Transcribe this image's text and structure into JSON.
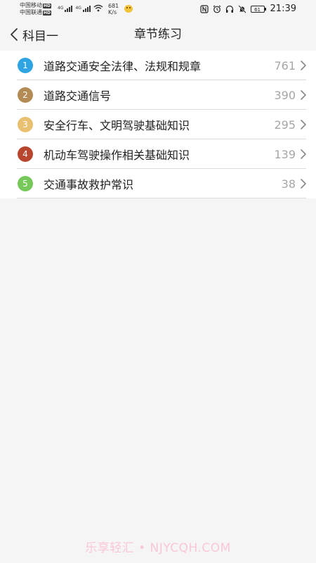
{
  "status_bar": {
    "carriers": [
      {
        "name": "中国移动",
        "badge": "HD"
      },
      {
        "name": "中国联通",
        "badge": "HD"
      }
    ],
    "network_type": "4G",
    "speed_value": "681",
    "speed_unit": "K/s",
    "battery_level": "61",
    "time": "21:39"
  },
  "nav": {
    "back_label": "科目一",
    "title": "章节练习"
  },
  "chapters": [
    {
      "number": "1",
      "title": "道路交通安全法律、法规和规章",
      "count": "761",
      "color": "#2ea4e3"
    },
    {
      "number": "2",
      "title": "道路交通信号",
      "count": "390",
      "color": "#b48a55"
    },
    {
      "number": "3",
      "title": "安全行车、文明驾驶基础知识",
      "count": "295",
      "color": "#e8c070"
    },
    {
      "number": "4",
      "title": "机动车驾驶操作相关基础知识",
      "count": "139",
      "color": "#b8462e"
    },
    {
      "number": "5",
      "title": "交通事故救护常识",
      "count": "38",
      "color": "#76c85a"
    }
  ],
  "watermark": "乐享轻汇 • NJYCQH.COM"
}
